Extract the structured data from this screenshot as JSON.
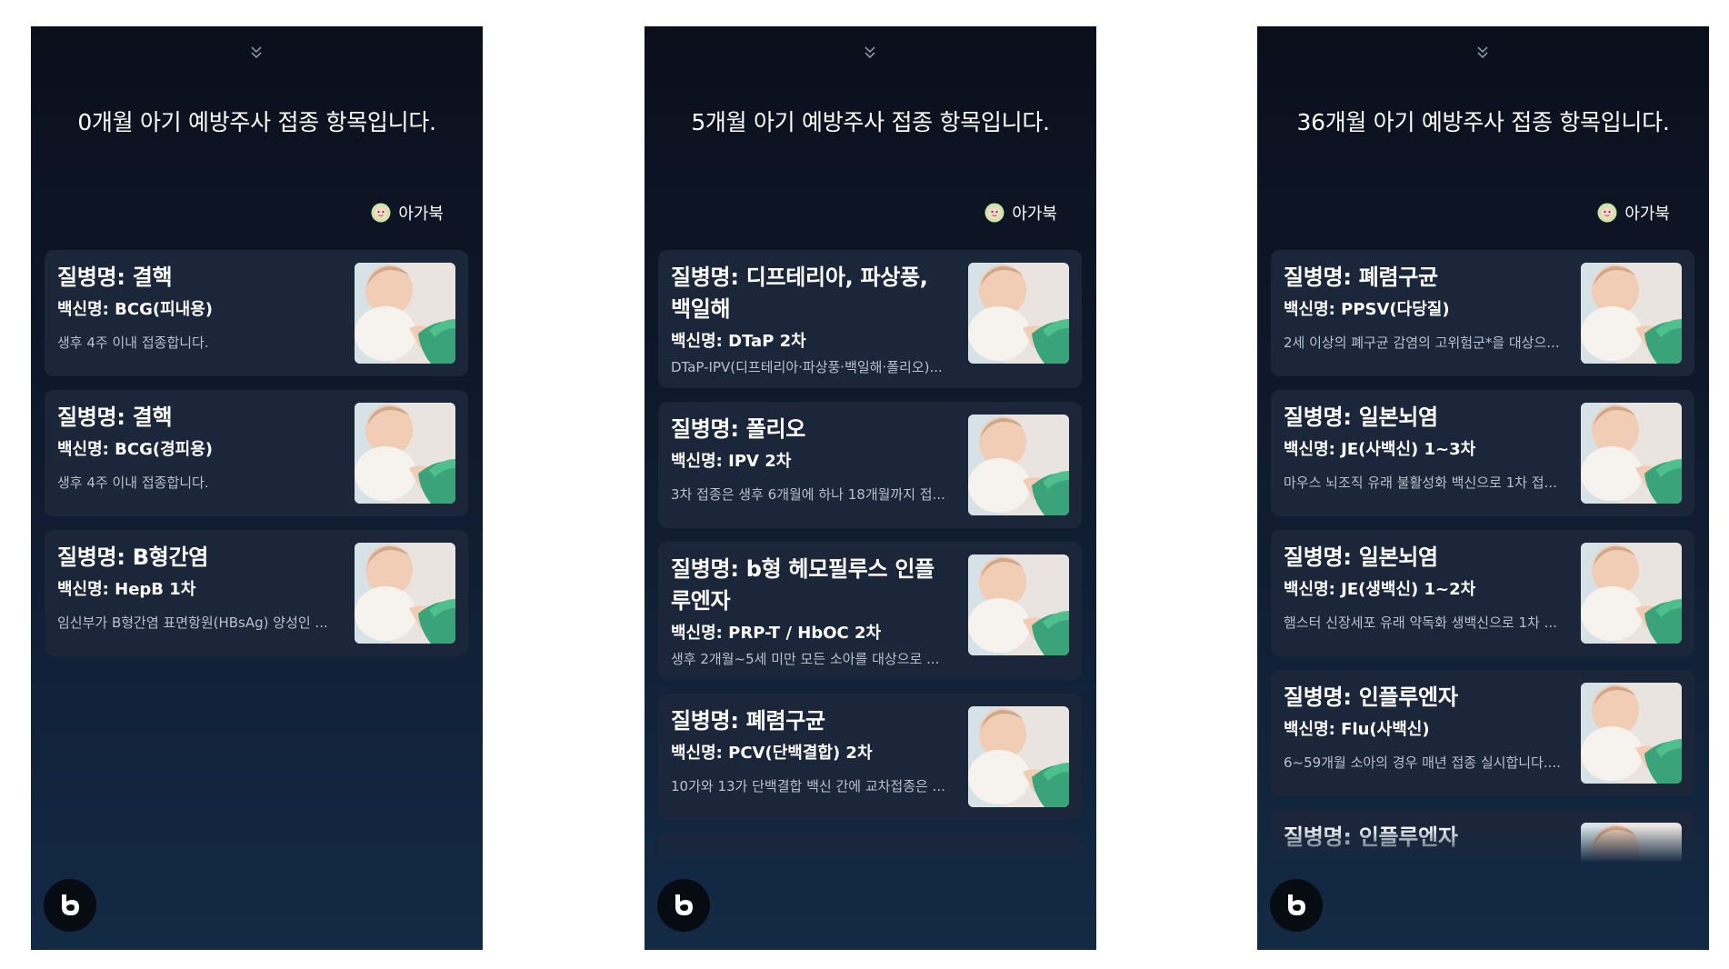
{
  "screens": [
    {
      "headline": "0개월 아기 예방주사 접종 항목입니다.",
      "source": "아가북",
      "cards": [
        {
          "title": "질병명: 결핵",
          "vaccine": "백신명: BCG(피내용)",
          "desc": "생후 4주 이내 접종합니다."
        },
        {
          "title": "질병명: 결핵",
          "vaccine": "백신명: BCG(경피용)",
          "desc": "생후 4주 이내 접종합니다."
        },
        {
          "title": "질병명: B형간염",
          "vaccine": "백신명: HepB 1차",
          "desc": "임신부가 B형간염 표면항원(HBsAg) 양성인 ..."
        }
      ]
    },
    {
      "headline": "5개월 아기 예방주사 접종 항목입니다.",
      "source": "아가북",
      "cards": [
        {
          "title": "질병명: 디프테리아, 파상풍, 백일해",
          "vaccine": "백신명: DTaP 2차",
          "desc": "DTaP-IPV(디프테리아·파상풍·백일해·폴리오)..."
        },
        {
          "title": "질병명: 폴리오",
          "vaccine": "백신명: IPV 2차",
          "desc": "3차 접종은 생후 6개월에 하나 18개월까지 접..."
        },
        {
          "title": "질병명: b형 헤모필루스 인플루엔자",
          "vaccine": "백신명: PRP-T / HbOC 2차",
          "desc": "생후 2개월~5세 미만 모든 소아를 대상으로 ..."
        },
        {
          "title": "질병명: 폐렴구균",
          "vaccine": "백신명: PCV(단백결합) 2차",
          "desc": "10가와 13가 단백결합 백신 간에 교차접종은 ..."
        }
      ]
    },
    {
      "headline": "36개월 아기 예방주사 접종 항목입니다.",
      "source": "아가북",
      "cards": [
        {
          "title": "질병명: 폐렴구균",
          "vaccine": "백신명: PPSV(다당질)",
          "desc": "2세 이상의 폐구균 감염의 고위험군*을 대상으..."
        },
        {
          "title": "질병명: 일본뇌염",
          "vaccine": "백신명: JE(사백신) 1~3차",
          "desc": "마우스 뇌조직 유래 불활성화 백신으로 1차 접..."
        },
        {
          "title": "질병명: 일본뇌염",
          "vaccine": "백신명: JE(생백신) 1~2차",
          "desc": "햄스터 신장세포 유래 약독화 생백신으로 1차 ..."
        },
        {
          "title": "질병명: 인플루엔자",
          "vaccine": "백신명: Flu(사백신)",
          "desc": "6~59개월 소아의 경우 매년 접종 실시합니다...."
        },
        {
          "title": "질병명: 인플루엔자",
          "vaccine": "",
          "desc": ""
        }
      ]
    }
  ],
  "icons": {
    "chevron": "double-chevron-down-icon",
    "source_logo": "agabook-logo-icon",
    "thumbnail": "baby-vaccination-photo",
    "bixby": "bixby-icon"
  },
  "colors": {
    "background_top": "#0b0f1c",
    "background_bottom": "#132a45",
    "card": "#1b263a",
    "text_primary": "#ffffff",
    "text_secondary": "#b9c0cc"
  }
}
